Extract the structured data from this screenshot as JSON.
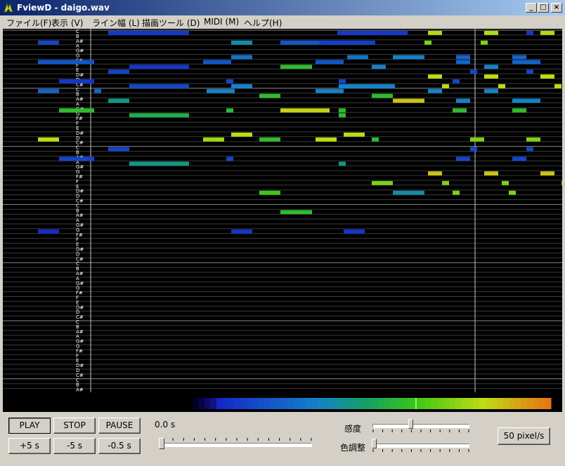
{
  "window": {
    "title": "FviewD - daigo.wav",
    "minimize": "_",
    "maximize": "□",
    "close": "×"
  },
  "menu": [
    {
      "label": "ファイル(F)"
    },
    {
      "label": "表示 (V)"
    },
    {
      "label": "ライン幅 (L)"
    },
    {
      "label": "描画ツール (D)"
    },
    {
      "label": "MIDI (M)"
    },
    {
      "label": "ヘルプ(H)"
    }
  ],
  "note_labels": [
    "C",
    "B",
    "A#",
    "A",
    "G#",
    "G",
    "F#",
    "F",
    "E",
    "D#",
    "D",
    "C#"
  ],
  "colors": {
    "background": "#000000",
    "grid": "#3a3a3a",
    "c_line": "#8a8a8a",
    "cursor": "#c8c8c8",
    "low": "#1e3cc8",
    "mid": "#1aa050",
    "high": "#c8e020"
  },
  "controls": {
    "play": "PLAY",
    "stop": "STOP",
    "pause": "PAUSE",
    "plus5": "+5 s",
    "minus5": "-5 s",
    "minus05": "-0.5 s",
    "time": "0.0 s",
    "sensitivity_label": "感度",
    "color_adjust_label": "色調整",
    "speed": "50 pixel/s",
    "position_value": 0.0,
    "sensitivity_value": 0.4,
    "color_adjust_value": 0.0
  }
}
